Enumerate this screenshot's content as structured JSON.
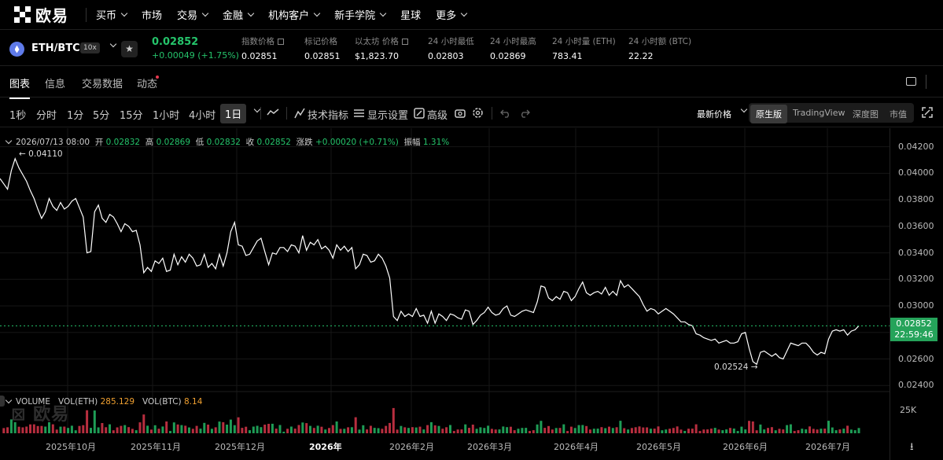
{
  "nav": {
    "logo": "欧易",
    "items": [
      {
        "label": "买币",
        "dropdown": true
      },
      {
        "label": "市场",
        "dropdown": false
      },
      {
        "label": "交易",
        "dropdown": true
      },
      {
        "label": "金融",
        "dropdown": true
      },
      {
        "label": "机构客户",
        "dropdown": true
      },
      {
        "label": "新手学院",
        "dropdown": true
      },
      {
        "label": "星球",
        "dropdown": false
      },
      {
        "label": "更多",
        "dropdown": true
      }
    ]
  },
  "ticker": {
    "pair": "ETH/BTC",
    "leverage": "10x",
    "last_price": "0.02852",
    "change": "+0.00049 (+1.75%)",
    "stats": [
      {
        "label": "指数价格",
        "value": "0.02851",
        "ext": true
      },
      {
        "label": "标记价格",
        "value": "0.02851",
        "ext": false
      },
      {
        "label": "以太坊 价格",
        "value": "$1,823.70",
        "ext": true
      },
      {
        "label": "24 小时最低",
        "value": "0.02803",
        "ext": false
      },
      {
        "label": "24 小时最高",
        "value": "0.02869",
        "ext": false
      },
      {
        "label": "24 小时量 (ETH)",
        "value": "783.41",
        "ext": false
      },
      {
        "label": "24 小时额 (BTC)",
        "value": "22.22",
        "ext": false
      }
    ]
  },
  "tabs": [
    "图表",
    "信息",
    "交易数据",
    "动态"
  ],
  "toolbar": {
    "intervals": [
      "1秒",
      "分时",
      "1分",
      "5分",
      "15分",
      "1小时",
      "4小时",
      "1日"
    ],
    "selected_interval": "1日",
    "indicators": "技术指标",
    "display": "显示设置",
    "advanced": "高级",
    "price_type": "最新价格",
    "views": [
      "原生版",
      "TradingView",
      "深度图",
      "市值"
    ],
    "selected_view": "原生版"
  },
  "ohlc": {
    "date": "2026/07/13 08:00",
    "open_label": "开",
    "open": "0.02832",
    "high_label": "高",
    "high": "0.02869",
    "low_label": "低",
    "low": "0.02832",
    "close_label": "收",
    "close": "0.02852",
    "change_label": "涨跌",
    "change": "+0.00020 (+0.71%)",
    "amp_label": "振幅",
    "amp": "1.31%"
  },
  "price_tag": {
    "price": "0.02852",
    "countdown": "22:59:46"
  },
  "annotations": {
    "high": "← 0.04110",
    "low": "0.02524 →"
  },
  "volume": {
    "title": "VOLUME",
    "eth_label": "VOL(ETH)",
    "eth": "285.129",
    "btc_label": "VOL(BTC)",
    "btc": "8.14",
    "axis_label": "25K"
  },
  "colors": {
    "up": "#25c46b",
    "down": "#e6394f",
    "line": "#ffffff",
    "tag": "#25a35a"
  },
  "chart_data": {
    "type": "line",
    "title": "",
    "y_ticks": [
      "0.04200",
      "0.04000",
      "0.03800",
      "0.03600",
      "0.03400",
      "0.03200",
      "0.03000",
      "0.02800",
      "0.02600",
      "0.02400"
    ],
    "ylim": [
      0.0236,
      0.0434
    ],
    "x_ticks": [
      "2025年10月",
      "2025年11月",
      "2025年12月",
      "2026年",
      "2026年2月",
      "2026年3月",
      "2026年4月",
      "2026年5月",
      "2026年6月",
      "2026年7月"
    ],
    "bold_x_tick": "2026年",
    "x_range": [
      "2025-09-09",
      "2026-07-13"
    ],
    "series": [
      {
        "values": [
          0.0396,
          0.0392,
          0.0388,
          0.0402,
          0.0411,
          0.0404,
          0.0399,
          0.0394,
          0.0387,
          0.0381,
          0.0373,
          0.0366,
          0.0371,
          0.0381,
          0.0375,
          0.0372,
          0.0378,
          0.0373,
          0.0375,
          0.0379,
          0.0381,
          0.0374,
          0.0367,
          0.034,
          0.0341,
          0.0371,
          0.0376,
          0.0366,
          0.0363,
          0.0369,
          0.0367,
          0.0362,
          0.0356,
          0.0362,
          0.036,
          0.0356,
          0.0357,
          0.0346,
          0.0325,
          0.0329,
          0.0326,
          0.0334,
          0.0332,
          0.0336,
          0.0326,
          0.0327,
          0.0339,
          0.0331,
          0.0337,
          0.0333,
          0.0339,
          0.0336,
          0.033,
          0.0331,
          0.0339,
          0.0329,
          0.0332,
          0.0328,
          0.0339,
          0.033,
          0.034,
          0.0356,
          0.0363,
          0.0346,
          0.0345,
          0.0338,
          0.0339,
          0.0344,
          0.0349,
          0.0351,
          0.0341,
          0.0331,
          0.034,
          0.0339,
          0.0344,
          0.0344,
          0.0341,
          0.0346,
          0.0345,
          0.034,
          0.0353,
          0.0342,
          0.0348,
          0.0346,
          0.035,
          0.0343,
          0.0345,
          0.0342,
          0.0336,
          0.0346,
          0.0342,
          0.0345,
          0.0341,
          0.0344,
          0.0328,
          0.0331,
          0.0339,
          0.0338,
          0.0333,
          0.0334,
          0.0339,
          0.0336,
          0.033,
          0.0321,
          0.0292,
          0.0289,
          0.0296,
          0.0292,
          0.0294,
          0.0292,
          0.0298,
          0.0292,
          0.0293,
          0.0287,
          0.0296,
          0.0287,
          0.0294,
          0.0292,
          0.0289,
          0.0294,
          0.0293,
          0.0291,
          0.029,
          0.0297,
          0.0296,
          0.0286,
          0.0289,
          0.0293,
          0.0295,
          0.0299,
          0.0295,
          0.0293,
          0.0294,
          0.0298,
          0.03,
          0.0293,
          0.0292,
          0.0294,
          0.0296,
          0.0297,
          0.0296,
          0.0295,
          0.0303,
          0.0315,
          0.0314,
          0.0306,
          0.0304,
          0.0307,
          0.0305,
          0.0311,
          0.031,
          0.0304,
          0.0307,
          0.0313,
          0.0318,
          0.031,
          0.0308,
          0.031,
          0.0311,
          0.0309,
          0.0314,
          0.0308,
          0.0311,
          0.0308,
          0.0319,
          0.0314,
          0.0316,
          0.0313,
          0.031,
          0.0307,
          0.0301,
          0.0296,
          0.0298,
          0.0297,
          0.0294,
          0.0296,
          0.0298,
          0.0296,
          0.0294,
          0.0291,
          0.0288,
          0.0288,
          0.0286,
          0.0285,
          0.0279,
          0.0278,
          0.0276,
          0.0275,
          0.0274,
          0.0275,
          0.0272,
          0.0273,
          0.0274,
          0.0272,
          0.0272,
          0.0273,
          0.0279,
          0.028,
          0.0268,
          0.0258,
          0.0256,
          0.0265,
          0.0266,
          0.0264,
          0.0262,
          0.0264,
          0.0261,
          0.026,
          0.0266,
          0.0272,
          0.0271,
          0.027,
          0.0272,
          0.0272,
          0.0269,
          0.0265,
          0.0263,
          0.0265,
          0.0264,
          0.0275,
          0.0281,
          0.0282,
          0.0281,
          0.0282,
          0.0278,
          0.0281,
          0.0282,
          0.0285
        ]
      }
    ]
  }
}
